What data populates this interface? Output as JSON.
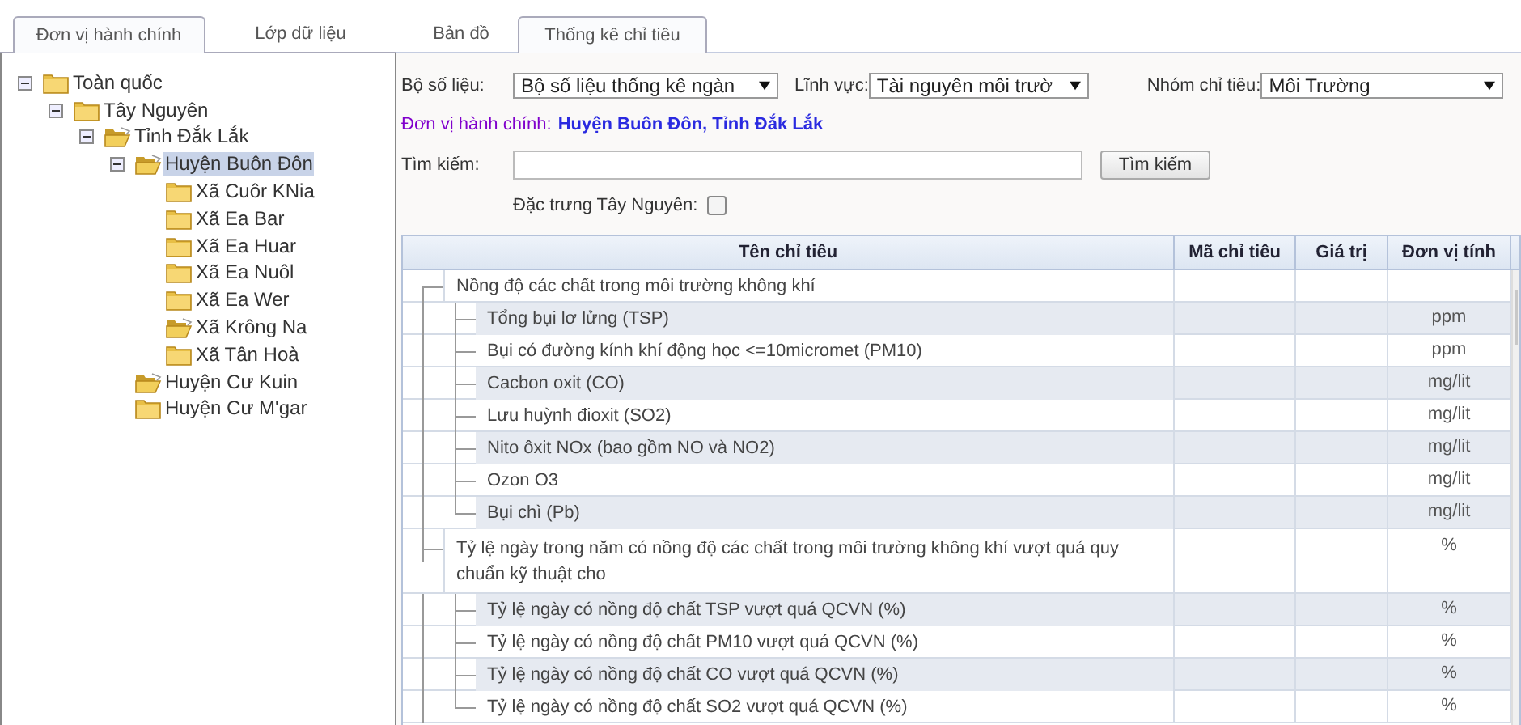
{
  "left_tabs": [
    {
      "label": "Đơn vị hành chính",
      "selected": true
    },
    {
      "label": "Lớp dữ liệu",
      "selected": false
    }
  ],
  "tree": [
    {
      "label": "Toàn quốc",
      "expanded": true,
      "folder_open": false,
      "selected": false,
      "children": [
        {
          "label": "Tây Nguyên",
          "expanded": true,
          "folder_open": false,
          "selected": false,
          "children": [
            {
              "label": "Tỉnh Đắk Lắk",
              "expanded": true,
              "folder_open": true,
              "selected": false,
              "children": [
                {
                  "label": "Huyện Buôn Đôn",
                  "expanded": true,
                  "folder_open": true,
                  "selected": true,
                  "children": [
                    {
                      "label": "Xã Cuôr KNia",
                      "folder_open": false,
                      "selected": false
                    },
                    {
                      "label": "Xã Ea Bar",
                      "folder_open": false,
                      "selected": false
                    },
                    {
                      "label": "Xã Ea Huar",
                      "folder_open": false,
                      "selected": false
                    },
                    {
                      "label": "Xã Ea Nuôl",
                      "folder_open": false,
                      "selected": false
                    },
                    {
                      "label": "Xã Ea Wer",
                      "folder_open": false,
                      "selected": false
                    },
                    {
                      "label": "Xã Krông Na",
                      "folder_open": true,
                      "selected": false
                    },
                    {
                      "label": "Xã Tân Hoà",
                      "folder_open": false,
                      "selected": false
                    }
                  ]
                },
                {
                  "label": "Huyện Cư Kuin",
                  "folder_open": true,
                  "selected": false
                },
                {
                  "label": "Huyện Cư M'gar",
                  "folder_open": false,
                  "selected": false
                }
              ]
            }
          ]
        }
      ]
    }
  ],
  "right_tabs": [
    {
      "label": "Bản đồ",
      "selected": false
    },
    {
      "label": "Thống kê chỉ tiêu",
      "selected": true
    }
  ],
  "filters": [
    {
      "label": "Bộ số liệu:",
      "value": "Bộ số liệu thống kê ngàn"
    },
    {
      "label": "Lĩnh vực:",
      "value": "Tài nguyên môi trườ"
    },
    {
      "label": "Nhóm chỉ tiêu:",
      "value": "Môi Trường"
    }
  ],
  "admin_unit": {
    "label": "Đơn vị hành chính:",
    "value": "Huyện Buôn Đôn, Tỉnh Đắk Lắk"
  },
  "search": {
    "label": "Tìm kiếm:",
    "button": "Tìm kiếm"
  },
  "highland_filter": {
    "label": "Đặc trưng Tây Nguyên:",
    "checked": false
  },
  "table": {
    "columns": [
      "Tên chỉ tiêu",
      "Mã chỉ tiêu",
      "Giá trị",
      "Đơn vị tính"
    ],
    "rows": [
      {
        "name": "Nồng độ các chất trong môi trường không khí",
        "unit": "",
        "children": [
          {
            "name": "Tổng bụi lơ lửng (TSP)",
            "unit": "ppm"
          },
          {
            "name": "Bụi có đường kính khí động học <=10micromet (PM10)",
            "unit": "ppm"
          },
          {
            "name": "Cacbon oxit (CO)",
            "unit": "mg/lit"
          },
          {
            "name": "Lưu huỳnh đioxit (SO2)",
            "unit": "mg/lit"
          },
          {
            "name": "Nito ôxit NOx (bao gồm NO và NO2)",
            "unit": "mg/lit"
          },
          {
            "name": "Ozon O3",
            "unit": "mg/lit"
          },
          {
            "name": "Bụi chì (Pb)",
            "unit": "mg/lit"
          }
        ]
      },
      {
        "name": "Tỷ lệ ngày trong năm có nồng độ các chất trong môi trường không khí vượt quá quy chuẩn kỹ thuật cho",
        "unit": "%",
        "children": [
          {
            "name": "Tỷ lệ ngày có nồng độ chất TSP vượt quá QCVN (%)",
            "unit": "%"
          },
          {
            "name": "Tỷ lệ ngày có nồng độ chất PM10 vượt quá QCVN (%)",
            "unit": "%"
          },
          {
            "name": "Tỷ lệ ngày có nồng độ chất CO vượt quá QCVN (%)",
            "unit": "%"
          },
          {
            "name": "Tỷ lệ ngày có nồng độ chất SO2 vượt quá QCVN (%)",
            "unit": "%"
          }
        ]
      }
    ]
  }
}
